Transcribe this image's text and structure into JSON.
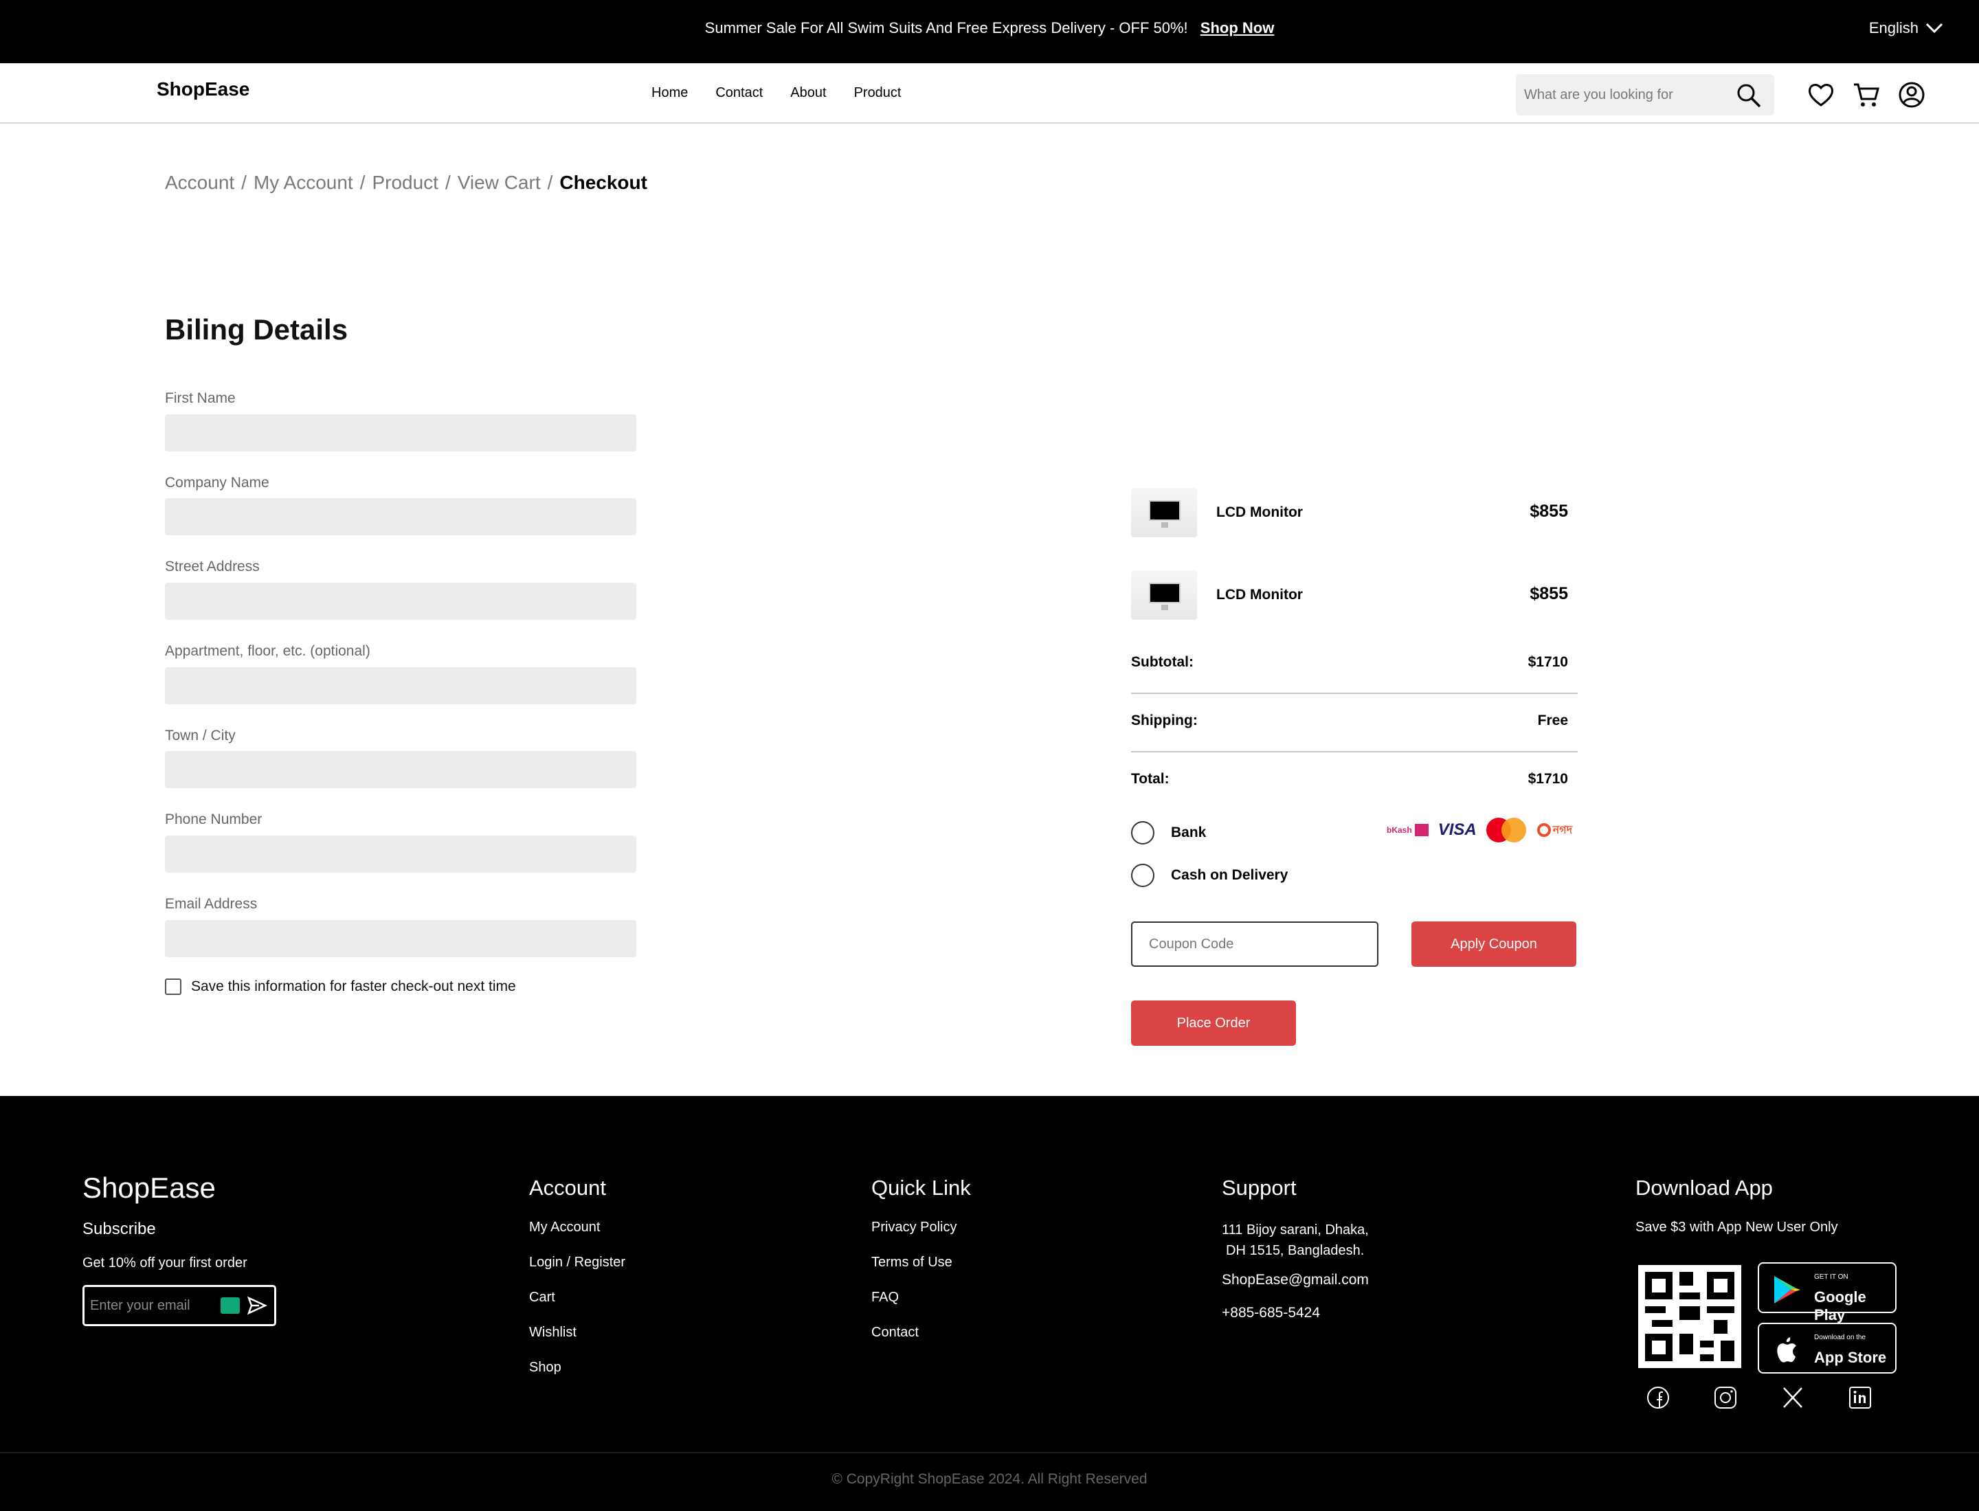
{
  "topbar": {
    "promo_text": "Summer Sale For All Swim Suits And Free Express Delivery - OFF 50%!",
    "shop_now": "Shop Now",
    "language": "English"
  },
  "header": {
    "logo": "ShopEase",
    "nav": [
      "Home",
      "Contact",
      "About",
      "Product"
    ],
    "search_placeholder": "What are you looking for"
  },
  "breadcrumb": {
    "items": [
      "Account",
      "My Account",
      "Product",
      "View Cart"
    ],
    "current": "Checkout",
    "separator": "/"
  },
  "billing": {
    "title": "Biling Details",
    "fields": [
      {
        "label": "First Name",
        "value": ""
      },
      {
        "label": "Company Name",
        "value": ""
      },
      {
        "label": "Street Address",
        "value": ""
      },
      {
        "label": "Appartment, floor, etc. (optional)",
        "value": ""
      },
      {
        "label": "Town / City",
        "value": ""
      },
      {
        "label": "Phone Number",
        "value": ""
      },
      {
        "label": "Email Address",
        "value": ""
      }
    ],
    "save_info": "Save this information for faster check-out next time"
  },
  "order": {
    "items": [
      {
        "name": "LCD Monitor",
        "price": "$855"
      },
      {
        "name": "LCD Monitor",
        "price": "$855"
      }
    ],
    "subtotal_label": "Subtotal:",
    "subtotal_value": "$1710",
    "shipping_label": "Shipping:",
    "shipping_value": "Free",
    "total_label": "Total:",
    "total_value": "$1710",
    "payment": {
      "bank": "Bank",
      "cod": "Cash on Delivery",
      "logos": {
        "bkash": "bKash",
        "visa": "VISA",
        "mastercard": "MasterCard",
        "nagad": "নগদ"
      }
    },
    "coupon_placeholder": "Coupon Code",
    "apply_coupon": "Apply Coupon",
    "place_order": "Place Order"
  },
  "footer": {
    "brand": "ShopEase",
    "subscribe": "Subscribe",
    "subscribe_text": "Get 10% off your first order",
    "email_placeholder": "Enter your email",
    "account": {
      "title": "Account",
      "links": [
        "My Account",
        "Login / Register",
        "Cart",
        "Wishlist",
        "Shop"
      ]
    },
    "quick_link": {
      "title": "Quick Link",
      "links": [
        "Privacy Policy",
        "Terms of Use",
        "FAQ",
        "Contact"
      ]
    },
    "support": {
      "title": "Support",
      "address_1": "111 Bijoy sarani, Dhaka,",
      "address_2": "DH 1515, Bangladesh.",
      "email": "ShopEase@gmail.com",
      "phone": "+885-685-5424"
    },
    "download": {
      "title": "Download App",
      "text": "Save $3 with App New User Only",
      "google_small": "GET IT ON",
      "google_big": "Google Play",
      "apple_small": "Download on the",
      "apple_big": "App Store"
    },
    "copyright": "© CopyRight ShopEase 2024. All Right Reserved"
  },
  "colors": {
    "accent": "#db4444",
    "topbar": "#000000",
    "input_bg": "#ececec"
  },
  "icons": [
    "search-icon",
    "heart-icon",
    "cart-icon",
    "user-icon",
    "chevron-down-icon",
    "send-icon",
    "facebook-icon",
    "instagram-icon",
    "x-icon",
    "linkedin-icon"
  ]
}
